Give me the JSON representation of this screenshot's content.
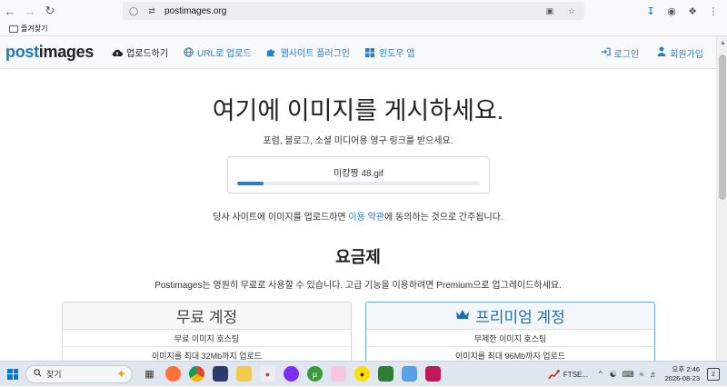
{
  "browser": {
    "url": "postimages.org",
    "bookmark_folder": "즐겨찾기"
  },
  "header": {
    "logo_post": "post",
    "logo_images": "images",
    "nav": [
      {
        "label": "업로드하기",
        "icon": "cloud-upload-icon"
      },
      {
        "label": "URL로 업로드",
        "icon": "globe-icon"
      },
      {
        "label": "웹사이트 플러그인",
        "icon": "puzzle-icon"
      },
      {
        "label": "윈도우 앱",
        "icon": "windows-icon"
      }
    ],
    "login": "로그인",
    "signup": "회원가입"
  },
  "hero": {
    "title": "여기에 이미지를 게시하세요.",
    "subtitle": "포럼, 블로그, 소셜 미디어용 영구 링크를 받으세요."
  },
  "upload": {
    "filename": "미캉짱 48.gif",
    "progress_fraction": 0.11
  },
  "terms": {
    "before": "당사 사이트에 이미지를 업로드하면 ",
    "link": "이용 약관",
    "after": "에 동의하는 것으로 간주됩니다."
  },
  "pricing": {
    "title": "요금제",
    "description": "Postimages는 영원히 무료로 사용할 수 있습니다. 고급 기능을 이용하려면 Premium으로 업그레이드하세요.",
    "free": {
      "title": "무료 계정",
      "rows": [
        "무료 이미지 호스팅",
        "이미지를 최대 32Mb까지 업로드"
      ]
    },
    "premium": {
      "title": "프리미엄 계정",
      "rows": [
        "무제한 이미지 호스팅",
        "이미지를 최대 96Mb까지 업로드"
      ]
    }
  },
  "taskbar": {
    "search_placeholder": "찾기",
    "tray_app_label": "FTSE...",
    "time": "오후 2:46",
    "date": "2026-08-23",
    "notification_count": "2"
  },
  "colors": {
    "accent": "#2f7dc3",
    "logo_blue": "#1e7bb8"
  }
}
